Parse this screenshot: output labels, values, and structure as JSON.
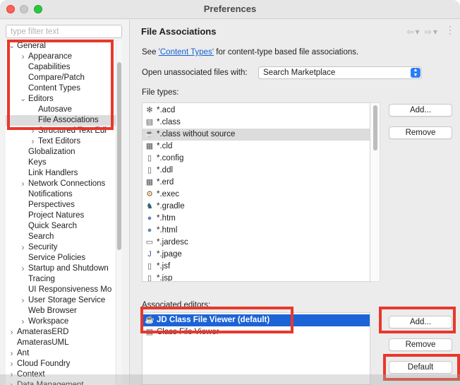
{
  "window": {
    "title": "Preferences"
  },
  "filter": {
    "placeholder": "type filter text",
    "value": ""
  },
  "tree": [
    {
      "label": "General",
      "twisty": "expanded"
    },
    {
      "label": "Appearance",
      "twisty": "collapsed"
    },
    {
      "label": "Capabilities",
      "twisty": ""
    },
    {
      "label": "Compare/Patch",
      "twisty": ""
    },
    {
      "label": "Content Types",
      "twisty": ""
    },
    {
      "label": "Editors",
      "twisty": "expanded"
    },
    {
      "label": "Autosave",
      "twisty": ""
    },
    {
      "label": "File Associations",
      "twisty": "",
      "selected": true
    },
    {
      "label": "Structured Text Edi",
      "twisty": "collapsed"
    },
    {
      "label": "Text Editors",
      "twisty": "collapsed"
    },
    {
      "label": "Globalization",
      "twisty": ""
    },
    {
      "label": "Keys",
      "twisty": ""
    },
    {
      "label": "Link Handlers",
      "twisty": ""
    },
    {
      "label": "Network Connections",
      "twisty": "collapsed"
    },
    {
      "label": "Notifications",
      "twisty": ""
    },
    {
      "label": "Perspectives",
      "twisty": ""
    },
    {
      "label": "Project Natures",
      "twisty": ""
    },
    {
      "label": "Quick Search",
      "twisty": ""
    },
    {
      "label": "Search",
      "twisty": ""
    },
    {
      "label": "Security",
      "twisty": "collapsed"
    },
    {
      "label": "Service Policies",
      "twisty": ""
    },
    {
      "label": "Startup and Shutdown",
      "twisty": "collapsed"
    },
    {
      "label": "Tracing",
      "twisty": ""
    },
    {
      "label": "UI Responsiveness Mo",
      "twisty": ""
    },
    {
      "label": "User Storage Service",
      "twisty": "collapsed"
    },
    {
      "label": "Web Browser",
      "twisty": ""
    },
    {
      "label": "Workspace",
      "twisty": "collapsed"
    },
    {
      "label": "AmaterasERD",
      "twisty": "collapsed"
    },
    {
      "label": "AmaterasUML",
      "twisty": ""
    },
    {
      "label": "Ant",
      "twisty": "collapsed"
    },
    {
      "label": "Cloud Foundry",
      "twisty": "collapsed"
    },
    {
      "label": "Context",
      "twisty": "collapsed"
    },
    {
      "label": "Data Management",
      "twisty": "collapsed"
    }
  ],
  "page": {
    "title": "File Associations",
    "see_prefix": "See ",
    "see_link": "'Content Types'",
    "see_suffix": " for content-type based file associations.",
    "open_label": "Open unassociated files with:",
    "open_value": "Search Marketplace",
    "file_types_label": "File types:",
    "associated_label": "Associated editors:"
  },
  "file_types": [
    {
      "name": "*.acd",
      "icon": "ant-icon"
    },
    {
      "name": "*.class",
      "icon": "class-file-icon"
    },
    {
      "name": "*.class without source",
      "icon": "coffee-cup-icon",
      "selected": true
    },
    {
      "name": "*.cld",
      "icon": "table-icon"
    },
    {
      "name": "*.config",
      "icon": "text-file-icon"
    },
    {
      "name": "*.ddl",
      "icon": "text-file-icon"
    },
    {
      "name": "*.erd",
      "icon": "table-icon"
    },
    {
      "name": "*.exec",
      "icon": "gears-icon"
    },
    {
      "name": "*.gradle",
      "icon": "elephant-icon"
    },
    {
      "name": "*.htm",
      "icon": "globe-icon"
    },
    {
      "name": "*.html",
      "icon": "globe-icon"
    },
    {
      "name": "*.jardesc",
      "icon": "jar-icon"
    },
    {
      "name": "*.jpage",
      "icon": "java-page-icon"
    },
    {
      "name": "*.jsf",
      "icon": "text-file-icon"
    },
    {
      "name": "*.jsp",
      "icon": "text-file-icon"
    }
  ],
  "editors": [
    {
      "name": "JD Class File Viewer (default)",
      "icon": "coffee-cup-icon",
      "selected": true
    },
    {
      "name": "Class File Viewer",
      "icon": "class-file-icon"
    }
  ],
  "buttons": {
    "add_types": "Add...",
    "remove_types": "Remove",
    "add_editor": "Add...",
    "remove_editor": "Remove",
    "default": "Default"
  },
  "colors": {
    "highlight": "#e8382b",
    "selection": "#1c63d6",
    "link": "#1463d1"
  }
}
